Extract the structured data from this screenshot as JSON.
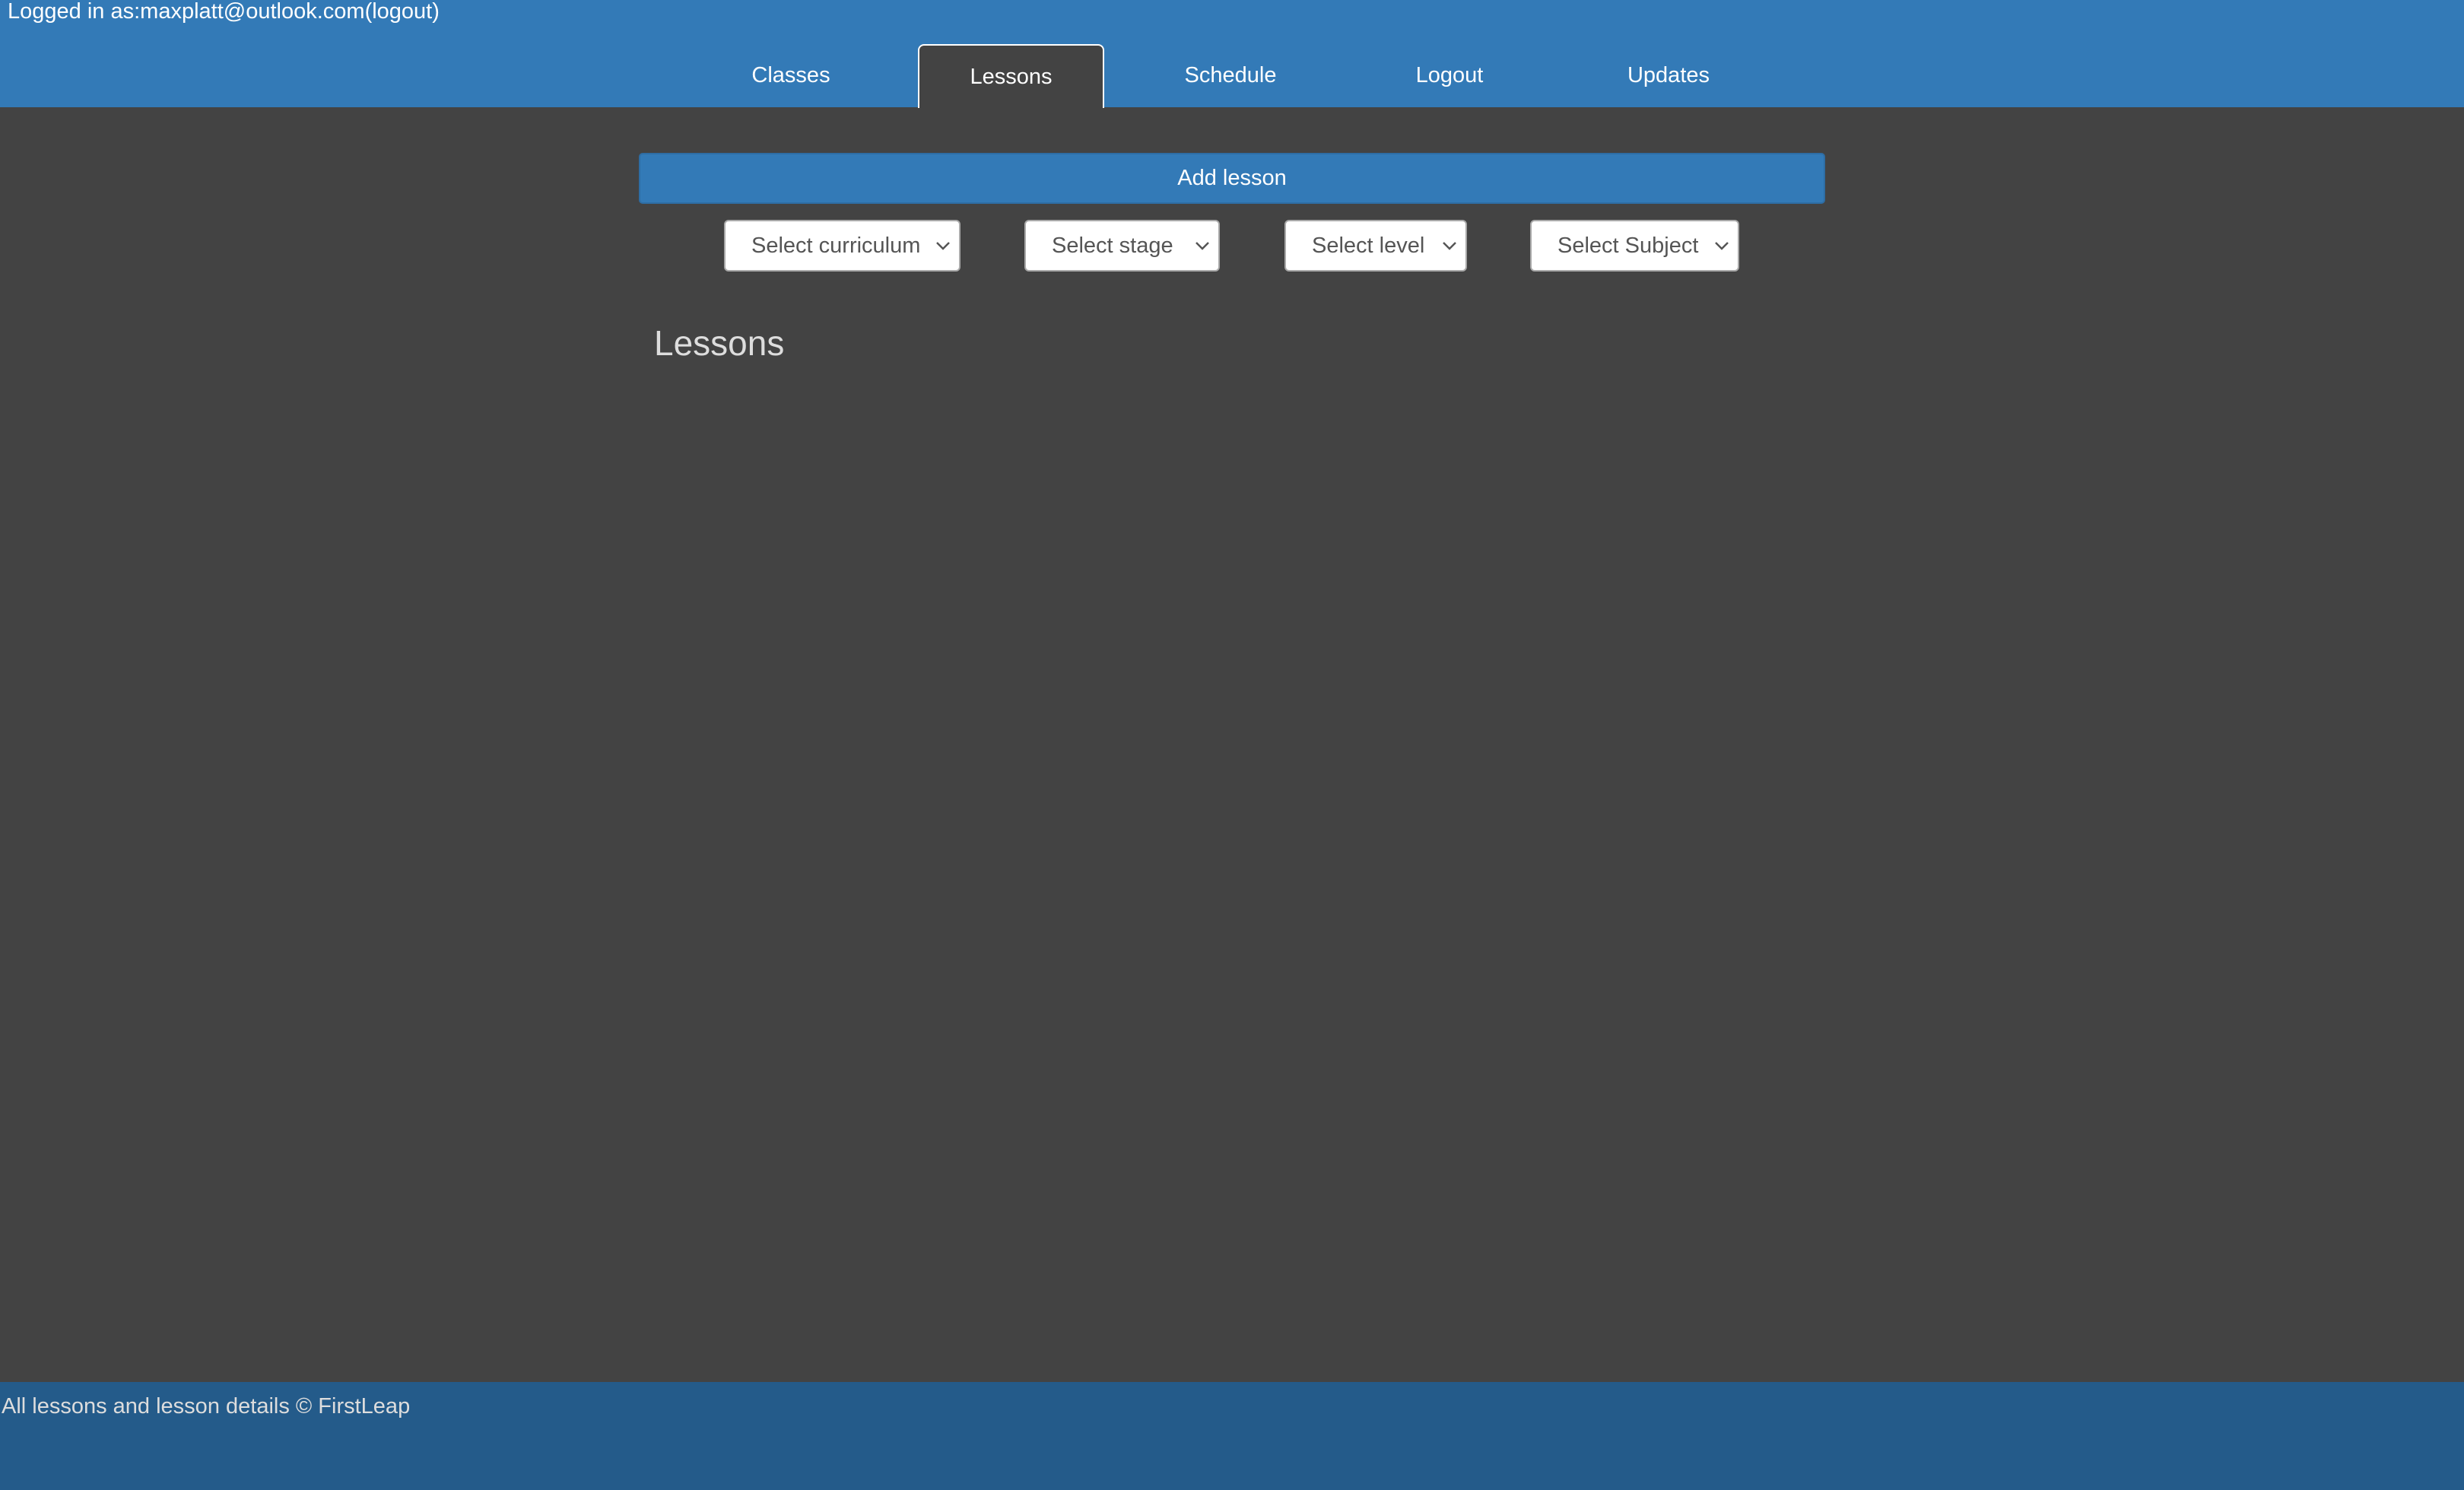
{
  "header": {
    "login_prefix": "Logged in as:",
    "user_email": "maxplatt@outlook.com",
    "logout_link": "(logout)"
  },
  "nav": {
    "tabs": [
      {
        "label": "Classes",
        "active": false
      },
      {
        "label": "Lessons",
        "active": true
      },
      {
        "label": "Schedule",
        "active": false
      },
      {
        "label": "Logout",
        "active": false
      },
      {
        "label": "Updates",
        "active": false
      }
    ]
  },
  "toolbar": {
    "add_lesson_label": "Add lesson"
  },
  "filters": {
    "curriculum": "Select curriculum",
    "stage": "Select stage",
    "level": "Select level",
    "subject": "Select Subject"
  },
  "main": {
    "title": "Lessons"
  },
  "footer": {
    "text": "All lessons and lesson details © FirstLeap"
  },
  "colors": {
    "header_bg": "#337ab7",
    "page_bg": "#434343",
    "footer_bg": "#245b8a"
  }
}
